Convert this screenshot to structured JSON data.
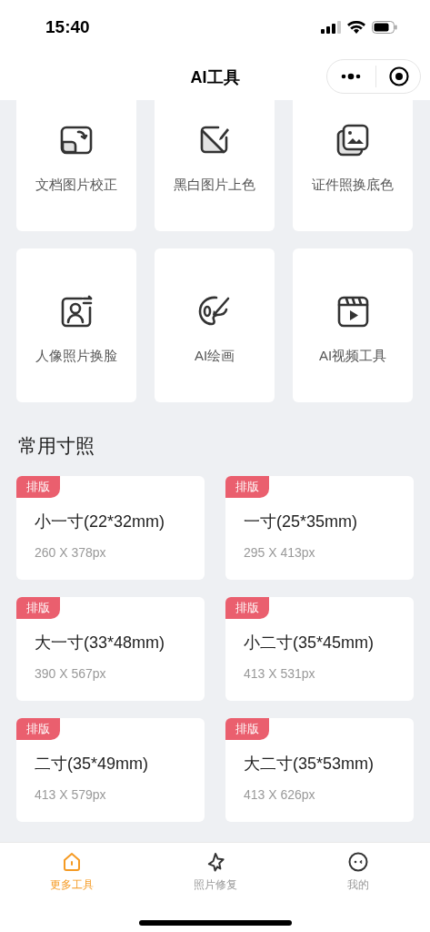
{
  "status_bar": {
    "time": "15:40"
  },
  "nav_bar": {
    "title": "AI工具"
  },
  "tools": [
    {
      "label": "文档图片校正"
    },
    {
      "label": "黑白图片上色"
    },
    {
      "label": "证件照换底色"
    },
    {
      "label": "人像照片换脸"
    },
    {
      "label": "AI绘画"
    },
    {
      "label": "AI视频工具"
    }
  ],
  "section_title": "常用寸照",
  "sizes": [
    {
      "badge": "排版",
      "name": "小一寸(22*32mm)",
      "pixels": "260 X 378px"
    },
    {
      "badge": "排版",
      "name": "一寸(25*35mm)",
      "pixels": "295 X 413px"
    },
    {
      "badge": "排版",
      "name": "大一寸(33*48mm)",
      "pixels": "390 X 567px"
    },
    {
      "badge": "排版",
      "name": "小二寸(35*45mm)",
      "pixels": "413 X 531px"
    },
    {
      "badge": "排版",
      "name": "二寸(35*49mm)",
      "pixels": "413 X 579px"
    },
    {
      "badge": "排版",
      "name": "大二寸(35*53mm)",
      "pixels": "413 X 626px"
    }
  ],
  "tab_bar": [
    {
      "label": "更多工具",
      "selected": true
    },
    {
      "label": "照片修复",
      "selected": false
    },
    {
      "label": "我的",
      "selected": false
    }
  ]
}
